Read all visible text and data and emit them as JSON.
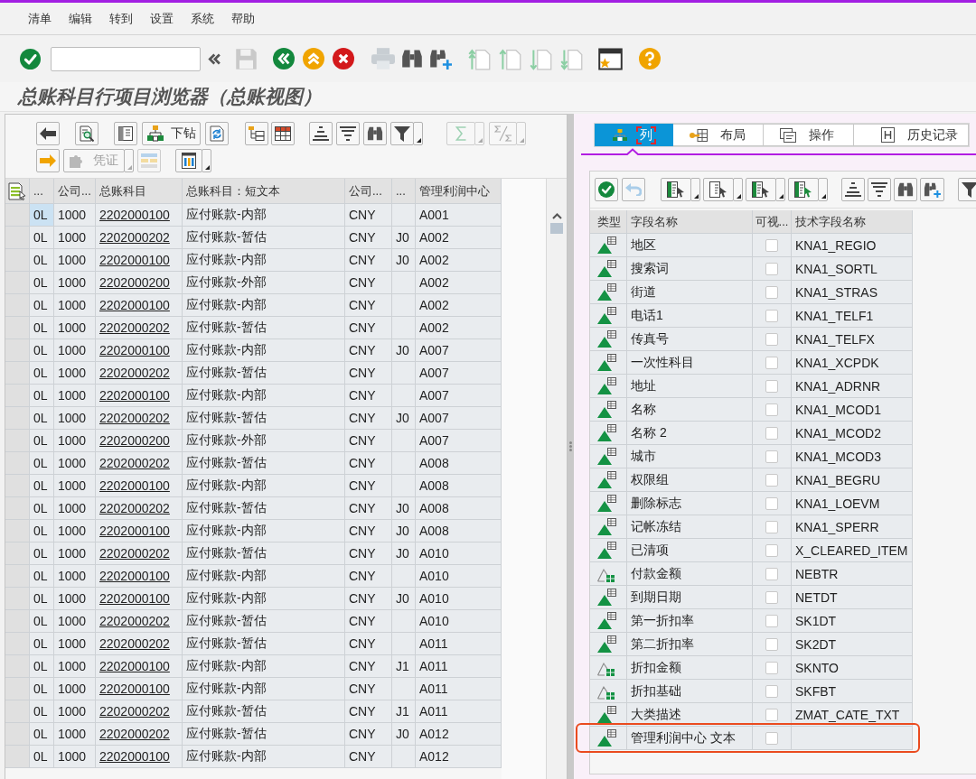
{
  "menu": [
    "清单",
    "编辑",
    "转到",
    "设置",
    "系统",
    "帮助"
  ],
  "title": "总账科目行项目浏览器（总账视图）",
  "left_toolbar": {
    "drilldown_button": {
      "label": "下钻",
      "disabled": false
    },
    "document_button": {
      "label": "凭证",
      "disabled": true
    }
  },
  "ledger_table": {
    "columns": [
      "...",
      "公司...",
      "总账科目",
      "总账科目：短文本",
      "公司...",
      "...",
      "管理利润中心"
    ],
    "rows": [
      {
        "column_1": "0L",
        "column_2": "1000",
        "account": "2202000100",
        "account_text": "应付账款-内部",
        "column_5": "CNY",
        "profit_center": "A001",
        "selected": true
      },
      {
        "column_1": "0L",
        "column_2": "1000",
        "account": "2202000202",
        "account_text": "应付账款-暂估",
        "column_5": "CNY",
        "column_6": "J0",
        "profit_center": "A002",
        "selected": false
      },
      {
        "column_1": "0L",
        "column_2": "1000",
        "account": "2202000100",
        "account_text": "应付账款-内部",
        "column_5": "CNY",
        "column_6": "J0",
        "profit_center": "A002",
        "selected": false
      },
      {
        "column_1": "0L",
        "column_2": "1000",
        "account": "2202000200",
        "account_text": "应付账款-外部",
        "column_5": "CNY",
        "profit_center": "A002",
        "selected": false
      },
      {
        "column_1": "0L",
        "column_2": "1000",
        "account": "2202000100",
        "account_text": "应付账款-内部",
        "column_5": "CNY",
        "profit_center": "A002",
        "selected": false
      },
      {
        "column_1": "0L",
        "column_2": "1000",
        "account": "2202000202",
        "account_text": "应付账款-暂估",
        "column_5": "CNY",
        "profit_center": "A002",
        "selected": false
      },
      {
        "column_1": "0L",
        "column_2": "1000",
        "account": "2202000100",
        "account_text": "应付账款-内部",
        "column_5": "CNY",
        "column_6": "J0",
        "profit_center": "A007",
        "selected": false
      },
      {
        "column_1": "0L",
        "column_2": "1000",
        "account": "2202000202",
        "account_text": "应付账款-暂估",
        "column_5": "CNY",
        "profit_center": "A007",
        "selected": false
      },
      {
        "column_1": "0L",
        "column_2": "1000",
        "account": "2202000100",
        "account_text": "应付账款-内部",
        "column_5": "CNY",
        "profit_center": "A007",
        "selected": false
      },
      {
        "column_1": "0L",
        "column_2": "1000",
        "account": "2202000202",
        "account_text": "应付账款-暂估",
        "column_5": "CNY",
        "column_6": "J0",
        "profit_center": "A007",
        "selected": false
      },
      {
        "column_1": "0L",
        "column_2": "1000",
        "account": "2202000200",
        "account_text": "应付账款-外部",
        "column_5": "CNY",
        "profit_center": "A007",
        "selected": false
      },
      {
        "column_1": "0L",
        "column_2": "1000",
        "account": "2202000202",
        "account_text": "应付账款-暂估",
        "column_5": "CNY",
        "profit_center": "A008",
        "selected": false
      },
      {
        "column_1": "0L",
        "column_2": "1000",
        "account": "2202000100",
        "account_text": "应付账款-内部",
        "column_5": "CNY",
        "profit_center": "A008",
        "selected": false
      },
      {
        "column_1": "0L",
        "column_2": "1000",
        "account": "2202000202",
        "account_text": "应付账款-暂估",
        "column_5": "CNY",
        "column_6": "J0",
        "profit_center": "A008",
        "selected": false
      },
      {
        "column_1": "0L",
        "column_2": "1000",
        "account": "2202000100",
        "account_text": "应付账款-内部",
        "column_5": "CNY",
        "column_6": "J0",
        "profit_center": "A008",
        "selected": false
      },
      {
        "column_1": "0L",
        "column_2": "1000",
        "account": "2202000202",
        "account_text": "应付账款-暂估",
        "column_5": "CNY",
        "column_6": "J0",
        "profit_center": "A010",
        "selected": false
      },
      {
        "column_1": "0L",
        "column_2": "1000",
        "account": "2202000100",
        "account_text": "应付账款-内部",
        "column_5": "CNY",
        "profit_center": "A010",
        "selected": false
      },
      {
        "column_1": "0L",
        "column_2": "1000",
        "account": "2202000100",
        "account_text": "应付账款-内部",
        "column_5": "CNY",
        "column_6": "J0",
        "profit_center": "A010",
        "selected": false
      },
      {
        "column_1": "0L",
        "column_2": "1000",
        "account": "2202000202",
        "account_text": "应付账款-暂估",
        "column_5": "CNY",
        "profit_center": "A010",
        "selected": false
      },
      {
        "column_1": "0L",
        "column_2": "1000",
        "account": "2202000202",
        "account_text": "应付账款-暂估",
        "column_5": "CNY",
        "profit_center": "A011",
        "selected": false
      },
      {
        "column_1": "0L",
        "column_2": "1000",
        "account": "2202000100",
        "account_text": "应付账款-内部",
        "column_5": "CNY",
        "column_6": "J1",
        "profit_center": "A011",
        "selected": false
      },
      {
        "column_1": "0L",
        "column_2": "1000",
        "account": "2202000100",
        "account_text": "应付账款-内部",
        "column_5": "CNY",
        "profit_center": "A011",
        "selected": false
      },
      {
        "column_1": "0L",
        "column_2": "1000",
        "account": "2202000202",
        "account_text": "应付账款-暂估",
        "column_5": "CNY",
        "column_6": "J1",
        "profit_center": "A011",
        "selected": false
      },
      {
        "column_1": "0L",
        "column_2": "1000",
        "account": "2202000202",
        "account_text": "应付账款-暂估",
        "column_5": "CNY",
        "column_6": "J0",
        "profit_center": "A012",
        "selected": false
      },
      {
        "column_1": "0L",
        "column_2": "1000",
        "account": "2202000100",
        "account_text": "应付账款-内部",
        "column_5": "CNY",
        "profit_center": "A012",
        "selected": false
      }
    ]
  },
  "layout_tabs": [
    {
      "label": "列",
      "selected": true
    },
    {
      "label": "布局",
      "selected": false
    },
    {
      "label": "操作",
      "selected": false
    },
    {
      "label": "历史记录",
      "selected": false
    }
  ],
  "field_table": {
    "columns": [
      "类型",
      "字段名称",
      "可视...",
      "技术字段名称"
    ],
    "rows": [
      {
        "kind": "characteristic",
        "name": "地区",
        "visible": false,
        "technical_name": "KNA1_REGIO",
        "highlighted": false
      },
      {
        "kind": "characteristic",
        "name": "搜索词",
        "visible": false,
        "technical_name": "KNA1_SORTL",
        "highlighted": false
      },
      {
        "kind": "characteristic",
        "name": "街道",
        "visible": false,
        "technical_name": "KNA1_STRAS",
        "highlighted": false
      },
      {
        "kind": "characteristic",
        "name": "电话1",
        "visible": false,
        "technical_name": "KNA1_TELF1",
        "highlighted": false
      },
      {
        "kind": "characteristic",
        "name": "传真号",
        "visible": false,
        "technical_name": "KNA1_TELFX",
        "highlighted": false
      },
      {
        "kind": "characteristic",
        "name": "一次性科目",
        "visible": false,
        "technical_name": "KNA1_XCPDK",
        "highlighted": false
      },
      {
        "kind": "characteristic",
        "name": "地址",
        "visible": false,
        "technical_name": "KNA1_ADRNR",
        "highlighted": false
      },
      {
        "kind": "characteristic",
        "name": "名称",
        "visible": false,
        "technical_name": "KNA1_MCOD1",
        "highlighted": false
      },
      {
        "kind": "characteristic",
        "name": "名称 2",
        "visible": false,
        "technical_name": "KNA1_MCOD2",
        "highlighted": false
      },
      {
        "kind": "characteristic",
        "name": "城市",
        "visible": false,
        "technical_name": "KNA1_MCOD3",
        "highlighted": false
      },
      {
        "kind": "characteristic",
        "name": "权限组",
        "visible": false,
        "technical_name": "KNA1_BEGRU",
        "highlighted": false
      },
      {
        "kind": "characteristic",
        "name": "删除标志",
        "visible": false,
        "technical_name": "KNA1_LOEVM",
        "highlighted": false
      },
      {
        "kind": "characteristic",
        "name": "记帐冻结",
        "visible": false,
        "technical_name": "KNA1_SPERR",
        "highlighted": false
      },
      {
        "kind": "characteristic",
        "name": "已清项",
        "visible": false,
        "technical_name": "X_CLEARED_ITEM",
        "highlighted": false
      },
      {
        "kind": "keyfigure",
        "name": "付款金额",
        "visible": false,
        "technical_name": "NEBTR",
        "highlighted": false
      },
      {
        "kind": "characteristic",
        "name": "到期日期",
        "visible": false,
        "technical_name": "NETDT",
        "highlighted": false
      },
      {
        "kind": "characteristic",
        "name": "第一折扣率",
        "visible": false,
        "technical_name": "SK1DT",
        "highlighted": false
      },
      {
        "kind": "characteristic",
        "name": "第二折扣率",
        "visible": false,
        "technical_name": "SK2DT",
        "highlighted": false
      },
      {
        "kind": "keyfigure",
        "name": "折扣金额",
        "visible": false,
        "technical_name": "SKNTO",
        "highlighted": false
      },
      {
        "kind": "keyfigure",
        "name": "折扣基础",
        "visible": false,
        "technical_name": "SKFBT",
        "highlighted": false
      },
      {
        "kind": "characteristic",
        "name": "大类描述",
        "visible": false,
        "technical_name": "ZMAT_CATE_TXT",
        "highlighted": false
      },
      {
        "kind": "characteristic",
        "name": "管理利润中心 文本",
        "visible": false,
        "highlighted": true
      }
    ]
  }
}
